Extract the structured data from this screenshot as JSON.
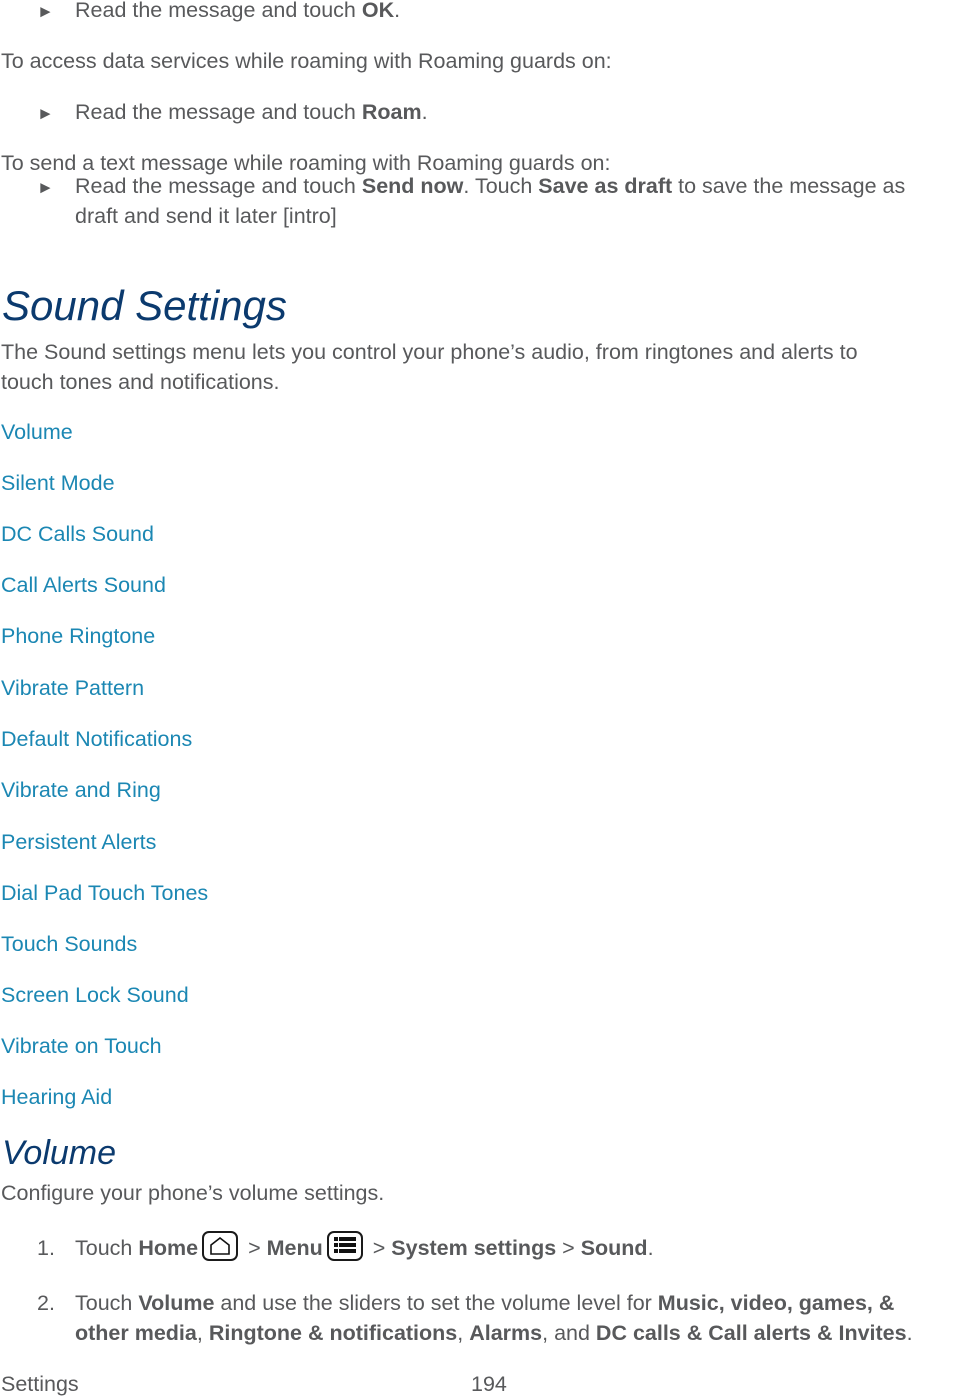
{
  "intro": {
    "bullet1": {
      "icon": "triangle-right-icon",
      "text_before": "Read the message and touch ",
      "bold": "OK",
      "text_after": "."
    },
    "para1": "To access data services while roaming with Roaming guards on:",
    "bullet2": {
      "icon": "triangle-right-icon",
      "text_before": "Read the message and touch ",
      "bold": "Roam",
      "text_after": "."
    },
    "para2": "To send a text message while roaming with Roaming guards on:",
    "bullet3": {
      "icon": "triangle-right-icon",
      "text_before": "Read the message and touch ",
      "bold1": "Send now",
      "text_mid": ". Touch ",
      "bold2": "Save as draft",
      "text_after": " to save the message as",
      "line2": "draft and send it later [intro]"
    }
  },
  "sound_settings": {
    "heading": "Sound Settings",
    "description_line1": "The Sound settings menu lets you control your phone’s audio, from ringtones and alerts to",
    "description_line2": "touch tones and notifications.",
    "links": [
      "Volume",
      "Silent Mode",
      "DC Calls Sound",
      "Call Alerts Sound",
      "Phone Ringtone",
      "Vibrate Pattern",
      "Default Notifications",
      "Vibrate and Ring",
      "Persistent Alerts",
      "Dial Pad Touch Tones",
      "Touch Sounds",
      "Screen Lock Sound",
      "Vibrate on Touch",
      "Hearing Aid"
    ],
    "link_color": "#1b87b3",
    "heading_color": "#0b3a6e"
  },
  "volume": {
    "heading": "Volume",
    "description": "Configure your phone’s volume settings.",
    "step1": {
      "number": "1.",
      "touch": "Touch ",
      "home": "Home",
      "home_icon": "home-icon",
      "sep1": " > ",
      "menu": "Menu",
      "menu_icon": "menu-icon",
      "sep2": " > ",
      "system_settings": "System settings",
      "sep3": " > ",
      "sound": "Sound",
      "end": "."
    },
    "step2": {
      "number": "2.",
      "touch": "Touch ",
      "volume": "Volume",
      "text1": " and use the sliders to set the volume level for ",
      "music": "Music, video, games, &",
      "music2": "other media",
      "comma1": ", ",
      "ringtone": "Ringtone & notifications",
      "comma2": ", ",
      "alarms": "Alarms",
      "and": ", and ",
      "dc": "DC calls & Call alerts & Invites",
      "end": "."
    }
  },
  "footer": {
    "section": "Settings",
    "page_number": "194"
  }
}
